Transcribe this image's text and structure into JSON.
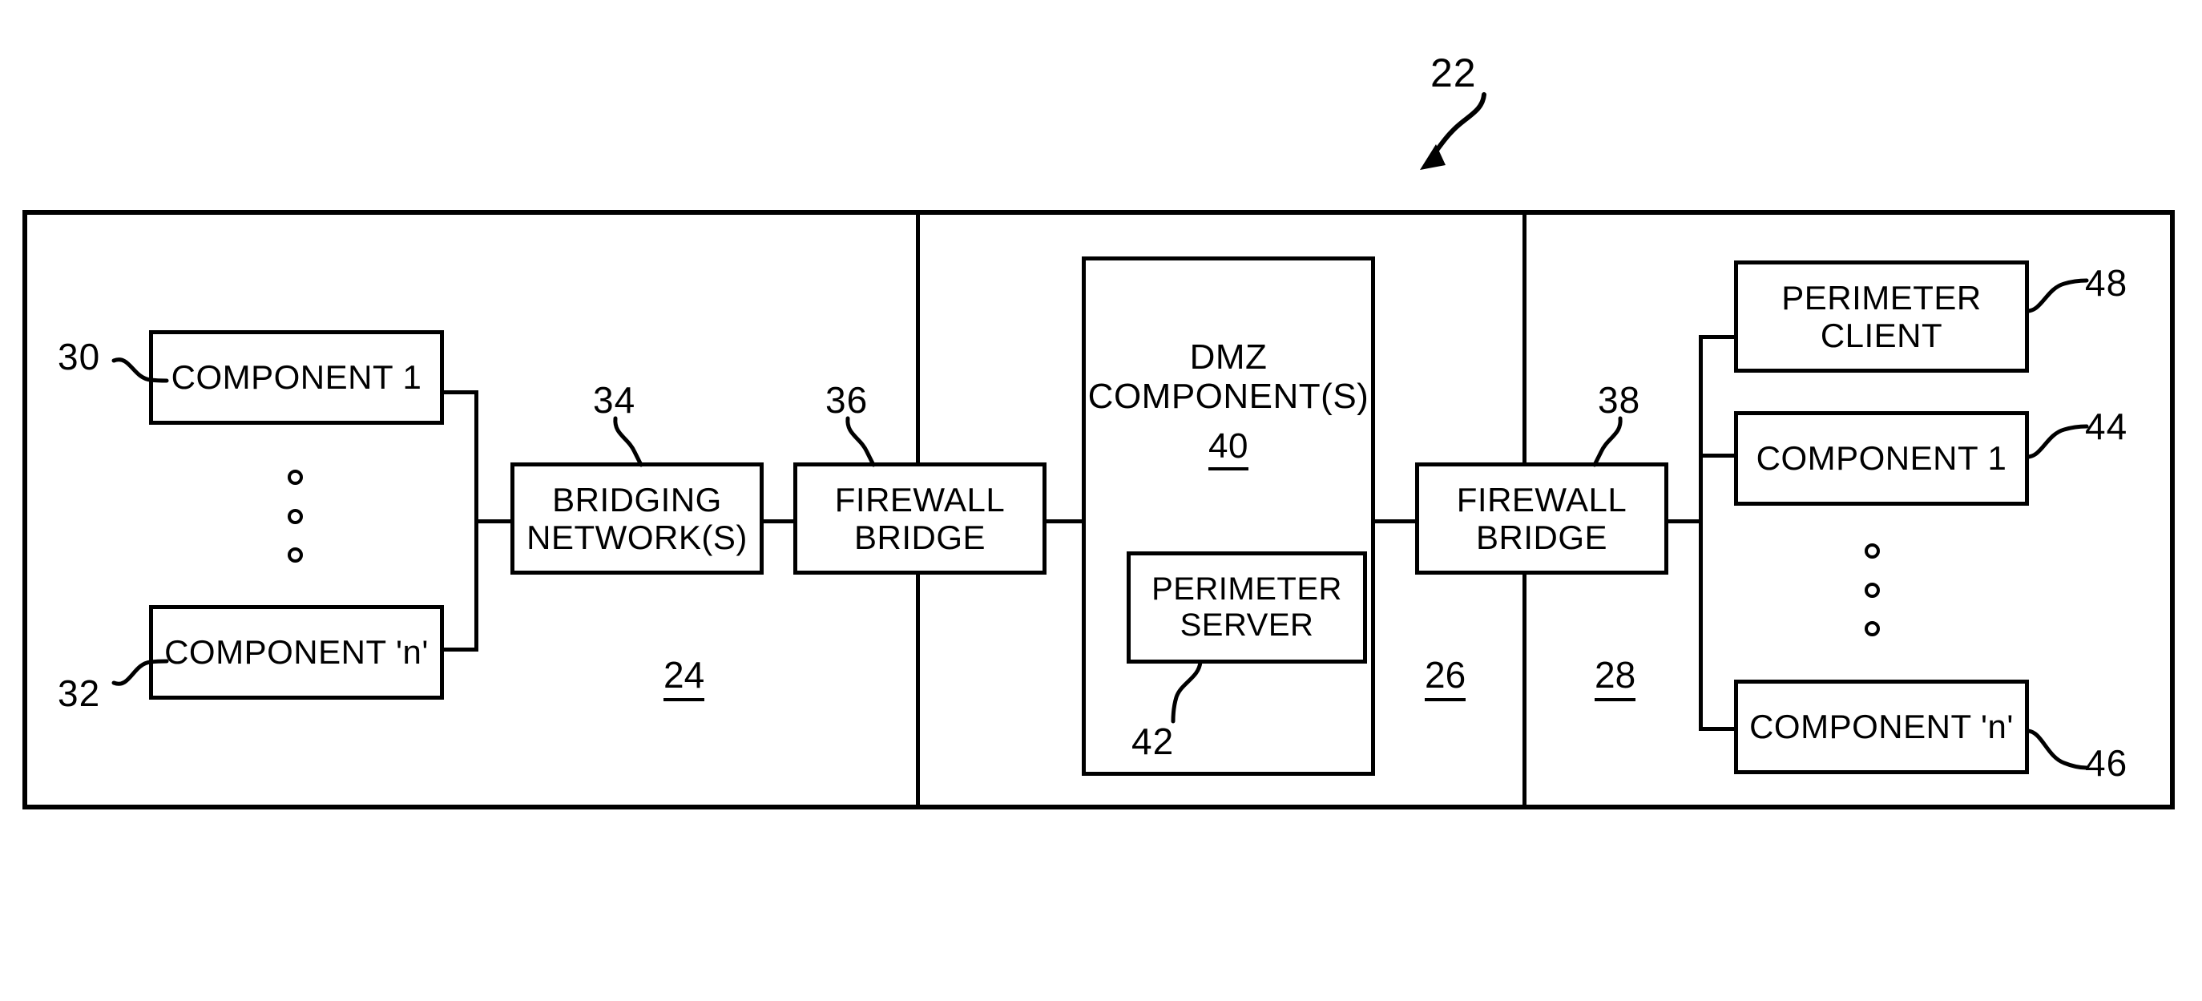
{
  "figure": {
    "overall_ref": "22"
  },
  "zones": [
    {
      "id": "enterprise-zone",
      "ref": "24"
    },
    {
      "id": "dmz-zone",
      "ref": "26"
    },
    {
      "id": "external-zone",
      "ref": "28"
    }
  ],
  "boxes": {
    "component_1_left": {
      "lines": [
        "COMPONENT 1"
      ],
      "ref": "30"
    },
    "component_n_left": {
      "lines": [
        "COMPONENT 'n'"
      ],
      "ref": "32"
    },
    "bridging_network": {
      "lines": [
        "BRIDGING",
        "NETWORK(S)"
      ],
      "ref": "34"
    },
    "firewall_bridge_1": {
      "lines": [
        "FIREWALL",
        "BRIDGE"
      ],
      "ref": "36"
    },
    "dmz_components": {
      "lines": [
        "DMZ",
        "COMPONENT(S)"
      ],
      "ref": "40"
    },
    "perimeter_server": {
      "lines": [
        "PERIMETER",
        "SERVER"
      ],
      "ref": "42"
    },
    "firewall_bridge_2": {
      "lines": [
        "FIREWALL",
        "BRIDGE"
      ],
      "ref": "38"
    },
    "perimeter_client": {
      "lines": [
        "PERIMETER",
        "CLIENT"
      ],
      "ref": "48"
    },
    "component_1_right": {
      "lines": [
        "COMPONENT 1"
      ],
      "ref": "44"
    },
    "component_n_right": {
      "lines": [
        "COMPONENT 'n'"
      ],
      "ref": "46"
    }
  },
  "ellipsis": {
    "glyph": "o",
    "count": 3
  },
  "colors": {
    "ink": "#000000",
    "paper": "#ffffff"
  }
}
